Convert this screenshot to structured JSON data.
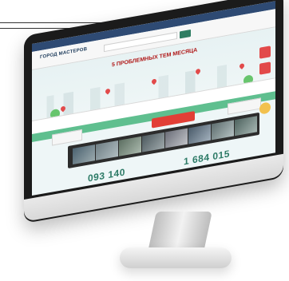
{
  "scene": {
    "description_text": {
      "logo_main": "ГОРОД МАСТЕРОВ",
      "logo_sub": "",
      "hero_title": "5 ПРОБЛЕМНЫХ ТЕМ МЕСЯЦА",
      "hero_sub": "",
      "cta": "",
      "side_cta_left": "",
      "side_cta_right": "",
      "stat_left_value": "093 140",
      "stat_right_value": "1 684 015"
    }
  }
}
